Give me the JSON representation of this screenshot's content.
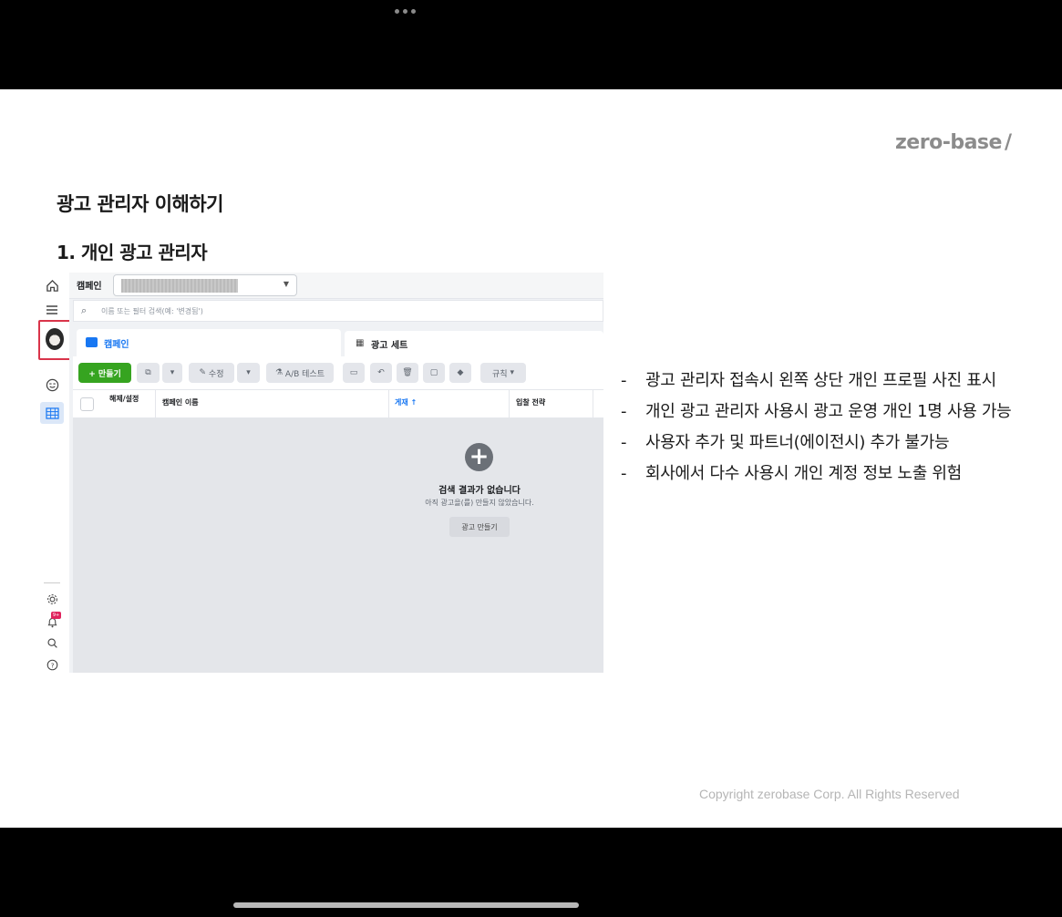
{
  "brand": {
    "name": "zero-base",
    "mark": "/"
  },
  "slide": {
    "title": "광고 관리자 이해하기",
    "subtitle": "1. 개인 광고 관리자",
    "bullets": [
      "광고 관리자 접속시 왼쪽 상단 개인 프로필 사진 표시",
      "개인 광고 관리자 사용시 광고 운영 개인 1명 사용 가능",
      "사용자 추가 및 파트너(에이전시) 추가 불가능",
      "회사에서 다수 사용시 개인 계정 정보 노출 위험"
    ],
    "bullet_marker": "-",
    "copyright": "Copyright zerobase Corp. All Rights Reserved"
  },
  "ads_manager": {
    "campaign_label": "캠페인",
    "search_placeholder": "이름 또는 필터 검색(예: '변경됨')",
    "tabs": {
      "campaign": "캠페인",
      "adset": "광고 세트"
    },
    "toolbar": {
      "create": "+ 만들기",
      "edit": "수정",
      "ab_test": "A/B 테스트",
      "rules": "규칙"
    },
    "columns": {
      "off_on": "해제/설정",
      "name": "캠페인 이름",
      "delivery": "게재 ↑",
      "bid_strategy": "입찰 전략"
    },
    "empty": {
      "title": "검색 결과가 없습니다",
      "subtitle": "아직 광고을(를) 만들지 않았습니다.",
      "button": "광고 만들기"
    },
    "notification_badge": "9+"
  },
  "colors": {
    "accent": "#1877f2",
    "create_button": "#36a420",
    "highlight_box": "#d9344a",
    "brand_grey": "#8c8c8c"
  },
  "icons": {
    "rail": [
      "home-icon",
      "menu-icon",
      "profile-avatar",
      "smiley-icon",
      "table-icon",
      "gear-icon",
      "bell-icon",
      "search-icon",
      "help-icon"
    ]
  }
}
